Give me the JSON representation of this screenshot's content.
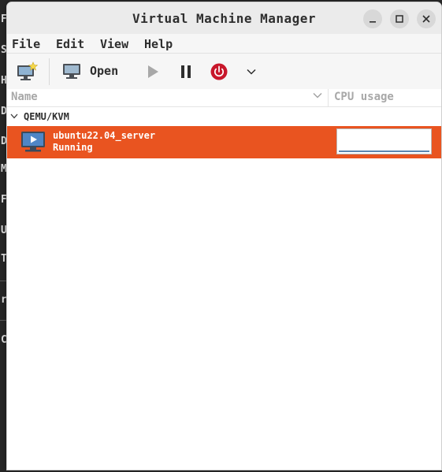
{
  "background": {
    "chars": [
      "F",
      "S",
      "H",
      "D",
      "D",
      "M",
      "F",
      "U",
      "T",
      "r",
      "C"
    ]
  },
  "window": {
    "title": "Virtual Machine Manager",
    "controls": [
      "minimize-icon",
      "maximize-icon",
      "close-icon"
    ]
  },
  "menubar": {
    "items": [
      {
        "label": "File"
      },
      {
        "label": "Edit"
      },
      {
        "label": "View"
      },
      {
        "label": "Help"
      }
    ]
  },
  "toolbar": {
    "new_vm_icon": "new-vm-icon",
    "open_label": "Open",
    "icons": [
      "monitor-icon",
      "play-icon",
      "pause-icon",
      "power-icon",
      "chevron-down-icon"
    ]
  },
  "list": {
    "columns": [
      {
        "label": "Name"
      },
      {
        "label": "CPU usage"
      }
    ],
    "group": {
      "label": "QEMU/KVM",
      "expanded": true
    },
    "vms": [
      {
        "name": "ubuntu22.04_server",
        "state": "Running",
        "cpu_usage_fraction": 0.02
      }
    ]
  },
  "colors": {
    "selection": "#e95420",
    "power": "#c8172b",
    "cpu_line": "#5b86b0"
  }
}
